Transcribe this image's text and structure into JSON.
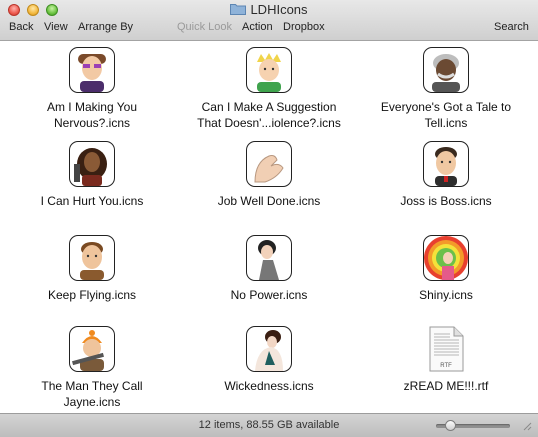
{
  "window": {
    "title": "LDHIcons",
    "toolbar": {
      "back": "Back",
      "view": "View",
      "arrange_by": "Arrange By",
      "quick_look": "Quick Look",
      "action": "Action",
      "dropbox": "Dropbox",
      "search": "Search"
    }
  },
  "files": [
    {
      "line1": "Am I Making You",
      "line2": "Nervous?.icns"
    },
    {
      "line1": "Can I Make A Suggestion",
      "line2": "That Doesn'...iolence?.icns"
    },
    {
      "line1": "Everyone's Got a Tale to",
      "line2": "Tell.icns"
    },
    {
      "line1": "I Can Hurt You.icns",
      "line2": ""
    },
    {
      "line1": "Job Well Done.icns",
      "line2": ""
    },
    {
      "line1": "Joss is Boss.icns",
      "line2": ""
    },
    {
      "line1": "Keep Flying.icns",
      "line2": ""
    },
    {
      "line1": "No Power.icns",
      "line2": ""
    },
    {
      "line1": "Shiny.icns",
      "line2": ""
    },
    {
      "line1": "The Man They Call",
      "line2": "Jayne.icns"
    },
    {
      "line1": "Wickedness.icns",
      "line2": ""
    },
    {
      "line1": "zREAD ME!!!.rtf",
      "line2": ""
    }
  ],
  "rtf_badge": "RTF",
  "status": {
    "text": "12 items, 88.55 GB available",
    "icon_size_level": 0.15
  },
  "colors": {
    "close": "#ee5a4f",
    "minimize": "#f3b940",
    "maximize": "#6cc342",
    "folder": "#8fb3d9"
  }
}
